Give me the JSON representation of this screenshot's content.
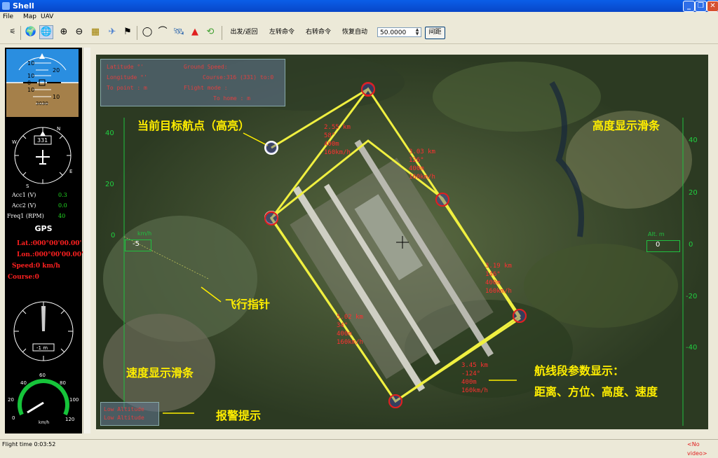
{
  "window": {
    "title": "Shell"
  },
  "menu": [
    "File",
    "Map",
    "UAV"
  ],
  "toolbar": {
    "cmd_depart_return": "出发/返回",
    "cmd_turn_left": "左转命令",
    "cmd_turn_right": "右转命令",
    "cmd_resume_auto": "恢复自动",
    "spacing_value": "50.0000",
    "spacing_button": "间距"
  },
  "attitude": {
    "pitch_ticks": [
      "10",
      "20",
      "10",
      "0",
      "10",
      "10"
    ],
    "heading_lbl": "3030"
  },
  "compass": {
    "heading_value": "331",
    "n": "N",
    "w": "W",
    "e": "E",
    "s": "S"
  },
  "sensors": [
    {
      "label": "Acc1 (V)",
      "value": "0.3"
    },
    {
      "label": "Acc2 (V)",
      "value": "0.0"
    },
    {
      "label": "Freq1 (RPM)",
      "value": "40"
    }
  ],
  "gps": {
    "title": "GPS",
    "lat": "Lat.:000°00'00.00'",
    "lon": "Lon.:000°00'00.00'",
    "speed": "Speed:0 km/h",
    "course": "Course:0"
  },
  "altimeter": {
    "readout": "-1 m"
  },
  "speedo": {
    "ticks": [
      "0",
      "20",
      "40",
      "60",
      "80",
      "100",
      "120"
    ],
    "unit": "km/h"
  },
  "info_panel": {
    "left": [
      "Latitude °'",
      "Longitude °'",
      "To point : m"
    ],
    "right": [
      "Ground Speed:",
      "Course:316 (331) to:0",
      "Flight mode :",
      "To home : m"
    ]
  },
  "segments": [
    {
      "dist": "2.55 km",
      "bearing": "58°",
      "alt": "400m",
      "speed": "160km/h"
    },
    {
      "dist": "3.03 km",
      "bearing": "126°",
      "alt": "400m",
      "speed": "160km/h"
    },
    {
      "dist": "3.19 km",
      "bearing": "146°",
      "alt": "400m",
      "speed": "160km/h"
    },
    {
      "dist": "3.45 km",
      "bearing": "-124°",
      "alt": "400m",
      "speed": "160km/h"
    },
    {
      "dist": "5.02 km",
      "bearing": "34°",
      "alt": "400m",
      "speed": "160km/h"
    }
  ],
  "speed_slider": {
    "ticks": [
      "40",
      "20",
      "0"
    ],
    "readout": "-5",
    "unit": "km/h"
  },
  "alt_slider": {
    "ticks": [
      "40",
      "20",
      "0",
      "-20",
      "-40"
    ],
    "readout": "0",
    "unit": "Alt. m"
  },
  "annotations": {
    "current_target": "当前目标航点（高亮）",
    "alt_slider": "高度显示滑条",
    "flight_pointer": "飞行指针",
    "speed_slider": "速度显示滑条",
    "segment_params": "航线段参数显示：",
    "segment_params2": "距离、方位、高度、速度",
    "alarm": "报警提示"
  },
  "alarm": {
    "line1": "Low Altitude",
    "line2": "Low Altitude"
  },
  "status": {
    "flight_time": "Flight time 0:03:52",
    "video": "No video"
  },
  "colors": {
    "route": "#f0f040",
    "waypoint": "#e02020",
    "annotation": "#ffee00",
    "slider": "#20c040"
  }
}
